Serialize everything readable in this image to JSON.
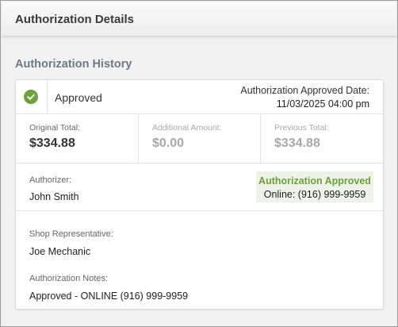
{
  "header": {
    "title": "Authorization Details"
  },
  "history": {
    "section_title": "Authorization History",
    "status": {
      "icon": "check-circle-icon",
      "label": "Approved",
      "color": "#6aa336"
    },
    "approved_date": {
      "label": "Authorization Approved Date:",
      "value": "11/03/2025 04:00 pm"
    },
    "totals": {
      "original": {
        "label": "Original Total:",
        "value": "$334.88"
      },
      "additional": {
        "label": "Additional Amount:",
        "value": "$0.00"
      },
      "previous": {
        "label": "Previous Total:",
        "value": "$334.88"
      }
    },
    "authorizer": {
      "label": "Authorizer:",
      "name": "John Smith"
    },
    "approval_badge": {
      "title": "Authorization Approved",
      "method": "Online: (916) 999-9959",
      "background": "#eef3e8"
    },
    "shop_rep": {
      "label": "Shop Representative:",
      "name": "Joe Mechanic"
    },
    "notes": {
      "label": "Authorization Notes:",
      "value": "Approved - ONLINE (916) 999-9959"
    }
  }
}
